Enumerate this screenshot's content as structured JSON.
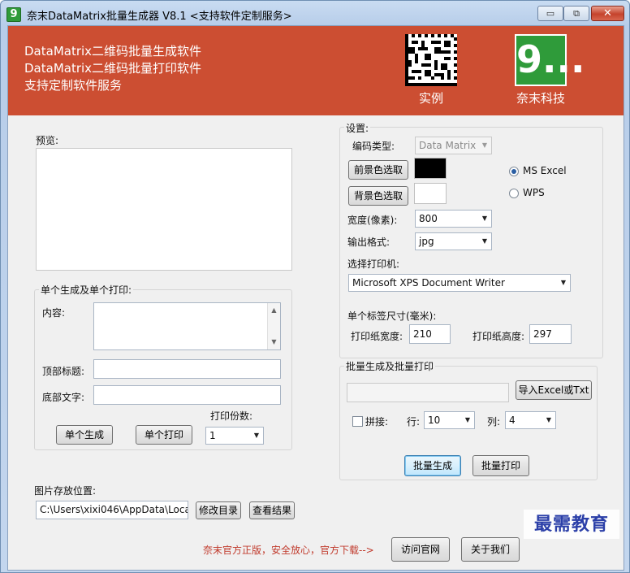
{
  "window": {
    "title": "奈末DataMatrix批量生成器 V8.1  <支持软件定制服务>",
    "controls": {
      "minimize": "▭",
      "maximize": "⧉",
      "close": "✕"
    }
  },
  "banner": {
    "line1": "DataMatrix二维码批量生成软件",
    "line2": "DataMatrix二维码批量打印软件",
    "line3": "支持定制软件服务",
    "example_caption": "实例",
    "brand_caption": "奈末科技",
    "brand_logo_text": "9..."
  },
  "preview": {
    "label": "预览:"
  },
  "single": {
    "group_title": "单个生成及单个打印:",
    "content_label": "内容:",
    "top_title_label": "顶部标题:",
    "bottom_text_label": "底部文字:",
    "copies_label": "打印份数:",
    "copies_value": "1",
    "generate_button": "单个生成",
    "print_button": "单个打印"
  },
  "storage": {
    "label": "图片存放位置:",
    "path": "C:\\Users\\xixi046\\AppData\\Local\\T",
    "change_button": "修改目录",
    "view_button": "查看结果"
  },
  "settings": {
    "group_title": "设置:",
    "encoding_label": "编码类型:",
    "encoding_value": "Data Matrix",
    "fg_button": "前景色选取",
    "bg_button": "背景色选取",
    "fg_color": "#000000",
    "bg_color": "#ffffff",
    "radio_excel": "MS  Excel",
    "radio_wps": "WPS",
    "width_label": "宽度(像素):",
    "width_value": "800",
    "format_label": "输出格式:",
    "format_value": "jpg",
    "printer_label": "选择打印机:",
    "printer_value": "Microsoft XPS Document Writer",
    "label_size_label": "单个标签尺寸(毫米):",
    "paper_width_label": "打印纸宽度:",
    "paper_width_value": "210",
    "paper_height_label": "打印纸高度:",
    "paper_height_value": "297"
  },
  "batch": {
    "group_title": "批量生成及批量打印",
    "import_button": "导入Excel或Txt",
    "tile_label": "拼接:",
    "row_label": "行:",
    "row_value": "10",
    "col_label": "列:",
    "col_value": "4",
    "generate_button": "批量生成",
    "print_button": "批量打印"
  },
  "footer": {
    "note": "奈末官方正版，安全放心，官方下载-->",
    "website_button": "访问官网",
    "about_button": "关于我们",
    "watermark": "最需教育"
  }
}
